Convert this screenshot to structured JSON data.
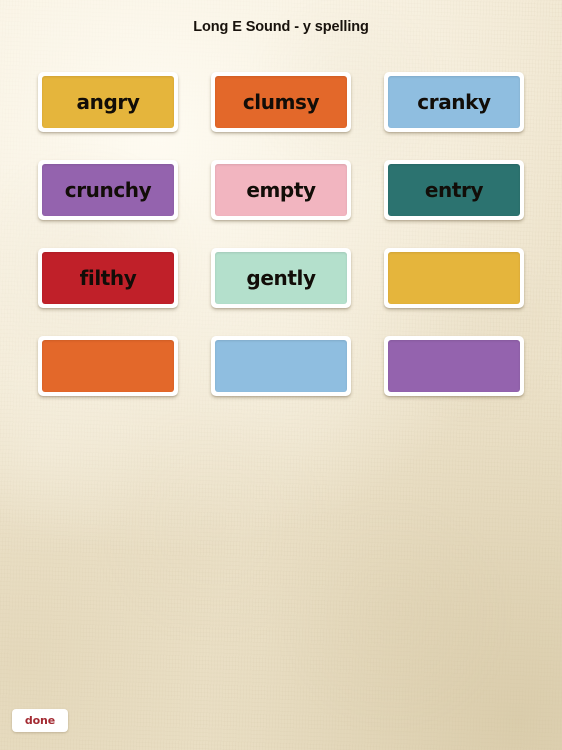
{
  "page": {
    "title": "Long E Sound - y spelling",
    "background_color": "#EFE5CE"
  },
  "grid": {
    "rows": [
      [
        {
          "word": "angry",
          "color": "#E5B53C",
          "empty": false
        },
        {
          "word": "clumsy",
          "color": "#E3682A",
          "empty": false
        },
        {
          "word": "cranky",
          "color": "#8FBEE0",
          "empty": false
        }
      ],
      [
        {
          "word": "crunchy",
          "color": "#9463AE",
          "empty": false
        },
        {
          "word": "empty",
          "color": "#F2B5C0",
          "empty": false
        },
        {
          "word": "entry",
          "color": "#2C7370",
          "empty": false
        }
      ],
      [
        {
          "word": "filthy",
          "color": "#C02029",
          "empty": false
        },
        {
          "word": "gently",
          "color": "#B4E0CC",
          "empty": false
        },
        {
          "word": "",
          "color": "#E5B53C",
          "empty": true
        }
      ],
      [
        {
          "word": "",
          "color": "#E3682A",
          "empty": true
        },
        {
          "word": "",
          "color": "#8FBEE0",
          "empty": true
        },
        {
          "word": "",
          "color": "#9463AE",
          "empty": true
        }
      ]
    ]
  },
  "footer": {
    "done_label": "done",
    "done_text_color": "#A32A32"
  }
}
